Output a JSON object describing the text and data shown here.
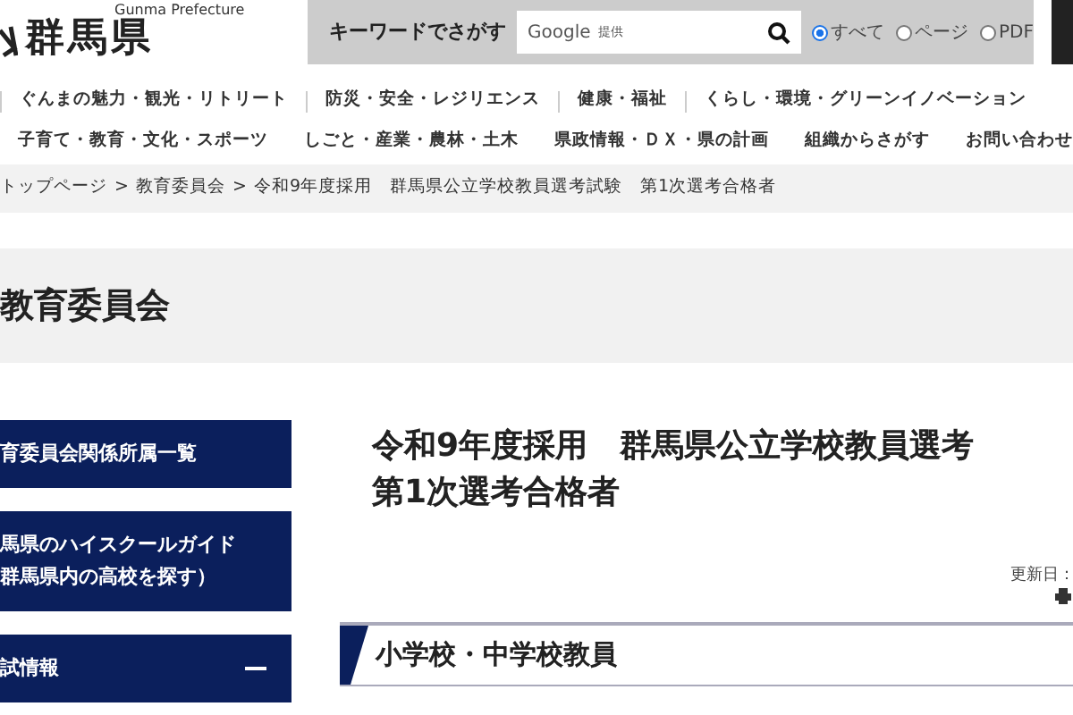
{
  "header": {
    "logo_subtitle": "Gunma Prefecture",
    "logo_title": "群馬県",
    "search": {
      "label": "キーワードでさがす",
      "placeholder": "提供",
      "provider": "Google",
      "scopes": [
        {
          "label": "すべて",
          "selected": true
        },
        {
          "label": "ページ",
          "selected": false
        },
        {
          "label": "PDF",
          "selected": false
        }
      ]
    }
  },
  "nav_rows": [
    [
      "ぐんまの魅力・観光・リトリート",
      "防災・安全・レジリエンス",
      "健康・福祉",
      "くらし・環境・グリーンイノベーション"
    ],
    [
      "子育て・教育・文化・スポーツ",
      "しごと・産業・農林・土木",
      "県政情報・ＤＸ・県の計画",
      "組織からさがす",
      "お問い合わせ"
    ]
  ],
  "breadcrumb": [
    "トップページ",
    "教育委員会",
    "令和9年度採用　群馬県公立学校教員選考試験　第1次選考合格者"
  ],
  "breadcrumb_separator": ">",
  "section_title": "教育委員会",
  "sidebar": {
    "items": [
      {
        "lines": [
          "育委員会関係所属一覧"
        ],
        "expanded": false
      },
      {
        "lines": [
          "馬県のハイスクールガイド",
          "群馬県内の高校を探す）"
        ],
        "expanded": false
      },
      {
        "lines": [
          "試情報"
        ],
        "expanded": true
      }
    ]
  },
  "article": {
    "title_lines": [
      "令和9年度採用　群馬県公立学校教員選考",
      "第1次選考合格者"
    ],
    "updated": "更新日：",
    "heading": "小学校・中学校教員"
  }
}
